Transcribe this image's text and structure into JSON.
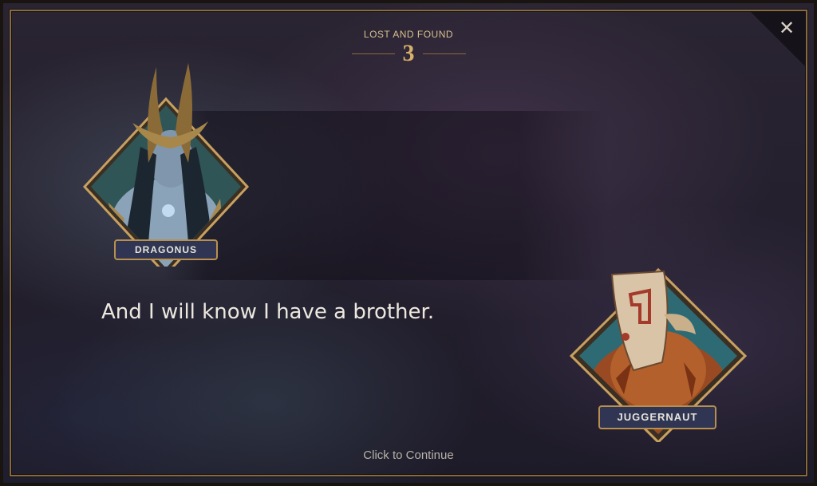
{
  "chapter": {
    "title": "LOST AND FOUND",
    "number": "3"
  },
  "speakers": {
    "left": {
      "name": "DRAGONUS",
      "icon": "dragonus-portrait"
    },
    "right": {
      "name": "JUGGERNAUT",
      "icon": "juggernaut-portrait"
    }
  },
  "dialogue": {
    "text": "And I will know I have a brother."
  },
  "actions": {
    "continue_label": "Click to Continue",
    "close_icon": "close-icon"
  },
  "colors": {
    "gold": "#b98f4e",
    "nameplate": "#2f3553",
    "text": "#ede8df"
  }
}
